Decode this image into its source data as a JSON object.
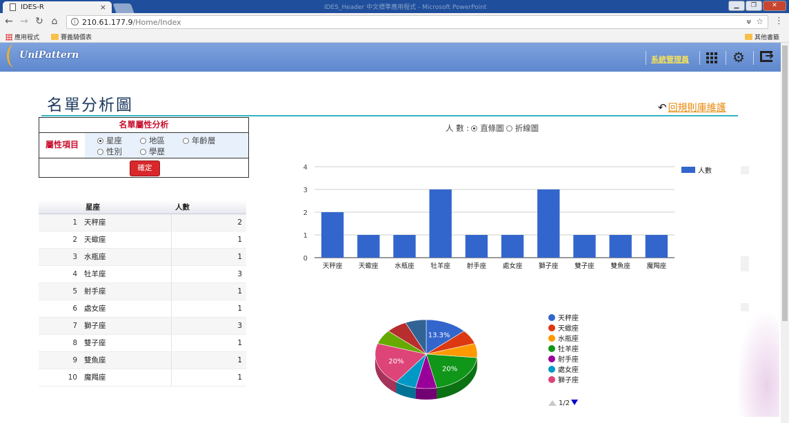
{
  "browser": {
    "tab_title": "IDES-R",
    "tab_close": "×",
    "window_title": "IDES_Header 中文標準應用程式 - Microsoft PowerPoint",
    "url_host": "210.61.177.9",
    "url_path": "/Home/Index",
    "info_glyph": "i",
    "bookmarks": {
      "apps": "應用程式",
      "price_table": "賽義騎價表",
      "other": "其他書籤"
    }
  },
  "header": {
    "logo_text": "UniPattern",
    "admin_link": "系統管理員"
  },
  "page": {
    "title": "名單分析圖",
    "back_link": "回規則庫維護"
  },
  "form": {
    "heading": "名單屬性分析",
    "label": "屬性項目",
    "options": [
      "星座",
      "地區",
      "年齡層",
      "性別",
      "學歷"
    ],
    "selected": "星座",
    "submit": "確定"
  },
  "table": {
    "col_name": "星座",
    "col_count": "人數",
    "rows": [
      {
        "idx": "1",
        "name": "天秤座",
        "count": "2"
      },
      {
        "idx": "2",
        "name": "天蠍座",
        "count": "1"
      },
      {
        "idx": "3",
        "name": "水瓶座",
        "count": "1"
      },
      {
        "idx": "4",
        "name": "牡羊座",
        "count": "3"
      },
      {
        "idx": "5",
        "name": "射手座",
        "count": "1"
      },
      {
        "idx": "6",
        "name": "處女座",
        "count": "1"
      },
      {
        "idx": "7",
        "name": "獅子座",
        "count": "3"
      },
      {
        "idx": "8",
        "name": "雙子座",
        "count": "1"
      },
      {
        "idx": "9",
        "name": "雙魚座",
        "count": "1"
      },
      {
        "idx": "10",
        "name": "魔羯座",
        "count": "1"
      }
    ]
  },
  "chart_controls": {
    "label": "人 數 :",
    "bar_option": "直條圖",
    "line_option": "折線圖",
    "selected": "直條圖"
  },
  "chart_data": [
    {
      "type": "bar",
      "categories": [
        "天秤座",
        "天蠍座",
        "水瓶座",
        "牡羊座",
        "射手座",
        "處女座",
        "獅子座",
        "雙子座",
        "雙魚座",
        "魔羯座"
      ],
      "series": [
        {
          "name": "人數",
          "values": [
            2,
            1,
            1,
            3,
            1,
            1,
            3,
            1,
            1,
            1
          ],
          "color": "#3366cc"
        }
      ],
      "ylim": [
        0,
        4
      ],
      "yticks": [
        "0",
        "1",
        "2",
        "3",
        "4"
      ],
      "grid": true,
      "legend": "right"
    },
    {
      "type": "pie",
      "style": "3d",
      "categories": [
        "天秤座",
        "天蠍座",
        "水瓶座",
        "牡羊座",
        "射手座",
        "處女座",
        "獅子座",
        "雙子座",
        "雙魚座",
        "魔羯座"
      ],
      "values": [
        2,
        1,
        1,
        3,
        1,
        1,
        3,
        1,
        1,
        1
      ],
      "colors": [
        "#3366cc",
        "#dc3912",
        "#ff9900",
        "#109618",
        "#990099",
        "#0099c6",
        "#dd4477",
        "#66aa00",
        "#b82e2e",
        "#316395"
      ],
      "slice_labels": [
        "13.3%",
        "20%",
        "20%"
      ],
      "legend": "right",
      "legend_visible": [
        "天秤座",
        "天蠍座",
        "水瓶座",
        "牡羊座",
        "射手座",
        "處女座",
        "獅子座"
      ],
      "legend_page": "1/2"
    }
  ]
}
